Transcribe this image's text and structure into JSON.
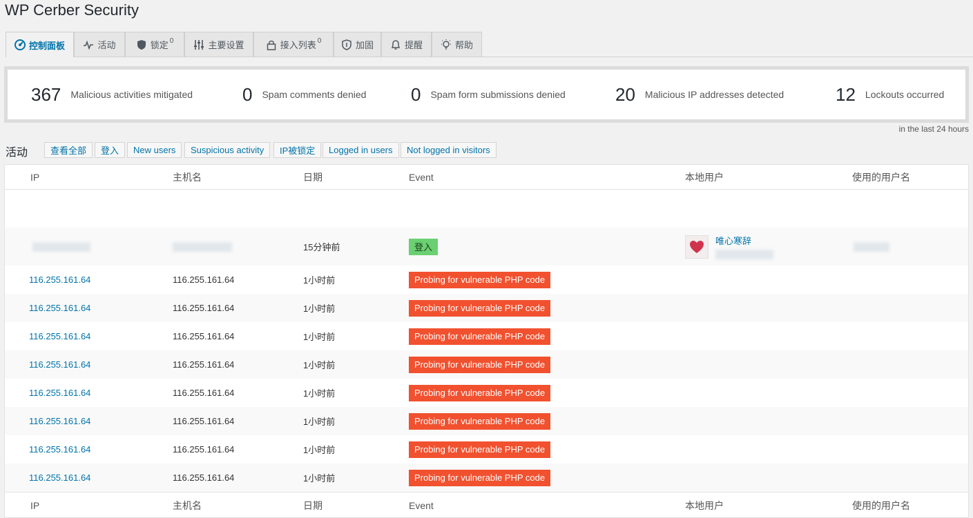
{
  "app": {
    "title": "WP Cerber Security"
  },
  "tabs": [
    {
      "label": "控制面板",
      "icon": "dashboard-icon",
      "active": true
    },
    {
      "label": "活动",
      "icon": "activity-pulse-icon"
    },
    {
      "label": "锁定",
      "icon": "shield-icon",
      "count": "0"
    },
    {
      "label": "主要设置",
      "icon": "sliders-icon"
    },
    {
      "label": "接入列表",
      "icon": "lock-icon",
      "count": "0"
    },
    {
      "label": "加固",
      "icon": "shield-outline-icon"
    },
    {
      "label": "提醒",
      "icon": "bell-icon"
    },
    {
      "label": "帮助",
      "icon": "lightbulb-icon"
    }
  ],
  "stats": [
    {
      "value": "367",
      "label": "Malicious activities mitigated"
    },
    {
      "value": "0",
      "label": "Spam comments denied"
    },
    {
      "value": "0",
      "label": "Spam form submissions denied"
    },
    {
      "value": "20",
      "label": "Malicious IP addresses detected"
    },
    {
      "value": "12",
      "label": "Lockouts occurred"
    }
  ],
  "stats_period": "in the last 24 hours",
  "activity": {
    "heading": "活动",
    "filters": [
      "查看全部",
      "登入",
      "New users",
      "Suspicious activity",
      "IP被锁定",
      "Logged in users",
      "Not logged in visitors"
    ]
  },
  "table": {
    "columns": [
      "IP",
      "主机名",
      "日期",
      "Event",
      "本地用户",
      "使用的用户名"
    ],
    "login_row": {
      "date": "15分钟前",
      "event": "登入",
      "user_name": "唯心寒辞"
    },
    "rows": [
      {
        "ip": "116.255.161.64",
        "host": "116.255.161.64",
        "date": "1小时前",
        "event": "Probing for vulnerable PHP code"
      },
      {
        "ip": "116.255.161.64",
        "host": "116.255.161.64",
        "date": "1小时前",
        "event": "Probing for vulnerable PHP code"
      },
      {
        "ip": "116.255.161.64",
        "host": "116.255.161.64",
        "date": "1小时前",
        "event": "Probing for vulnerable PHP code"
      },
      {
        "ip": "116.255.161.64",
        "host": "116.255.161.64",
        "date": "1小时前",
        "event": "Probing for vulnerable PHP code"
      },
      {
        "ip": "116.255.161.64",
        "host": "116.255.161.64",
        "date": "1小时前",
        "event": "Probing for vulnerable PHP code"
      },
      {
        "ip": "116.255.161.64",
        "host": "116.255.161.64",
        "date": "1小时前",
        "event": "Probing for vulnerable PHP code"
      },
      {
        "ip": "116.255.161.64",
        "host": "116.255.161.64",
        "date": "1小时前",
        "event": "Probing for vulnerable PHP code"
      },
      {
        "ip": "116.255.161.64",
        "host": "116.255.161.64",
        "date": "1小时前",
        "event": "Probing for vulnerable PHP code"
      }
    ]
  },
  "colors": {
    "link": "#0073aa",
    "event_danger": "#f1512f",
    "event_login": "#6ad071"
  }
}
